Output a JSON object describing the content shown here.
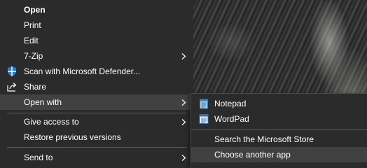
{
  "context_menu": {
    "items": [
      {
        "label": "Open"
      },
      {
        "label": "Print"
      },
      {
        "label": "Edit"
      },
      {
        "label": "7-Zip"
      },
      {
        "label": "Scan with Microsoft Defender..."
      },
      {
        "label": "Share"
      },
      {
        "label": "Open with"
      },
      {
        "label": "Give access to"
      },
      {
        "label": "Restore previous versions"
      },
      {
        "label": "Send to"
      }
    ]
  },
  "open_with_submenu": {
    "items": [
      {
        "label": "Notepad",
        "icon": "notepad-icon"
      },
      {
        "label": "WordPad",
        "icon": "wordpad-icon"
      },
      {
        "label": "Search the Microsoft Store"
      },
      {
        "label": "Choose another app"
      }
    ]
  },
  "colors": {
    "menu_background": "#2b2b2b",
    "highlight": "#414141",
    "separator": "#5a5a5a",
    "text": "#ffffff"
  }
}
